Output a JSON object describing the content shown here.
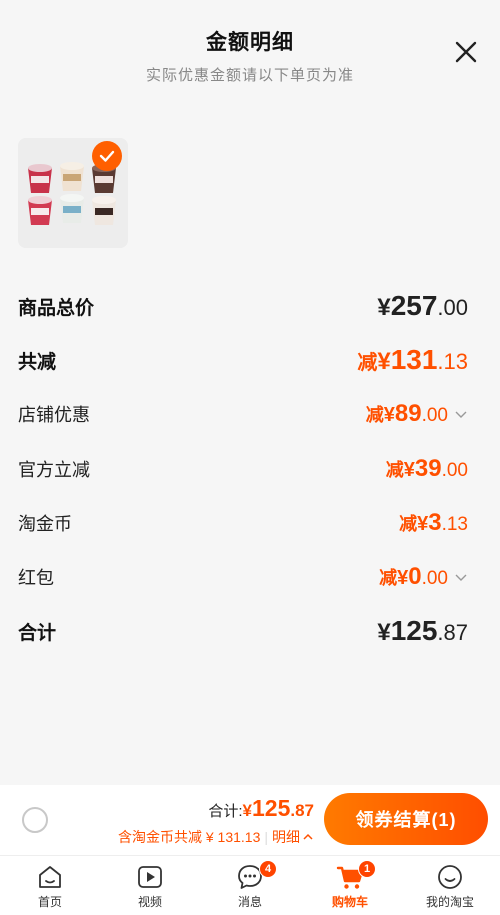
{
  "header": {
    "title": "金额明细",
    "subtitle": "实际优惠金额请以下单页为准"
  },
  "rows": {
    "subtotal": {
      "label": "商品总价",
      "yen": "¥",
      "int": "257",
      "dec": ".00"
    },
    "total_discount": {
      "label": "共减",
      "prefix": "减",
      "yen": "¥",
      "int": "131",
      "dec": ".13"
    },
    "store_coupon": {
      "label": "店铺优惠",
      "prefix": "减",
      "yen": "¥",
      "int": "89",
      "dec": ".00"
    },
    "official_discount": {
      "label": "官方立减",
      "prefix": "减",
      "yen": "¥",
      "int": "39",
      "dec": ".00"
    },
    "taojinbi": {
      "label": "淘金币",
      "prefix": "减",
      "yen": "¥",
      "int": "3",
      "dec": ".13"
    },
    "red_packet": {
      "label": "红包",
      "prefix": "减",
      "yen": "¥",
      "int": "0",
      "dec": ".00"
    },
    "grand_total": {
      "label": "合计",
      "yen": "¥",
      "int": "125",
      "dec": ".87"
    }
  },
  "checkout_bar": {
    "total_label": "合计:",
    "total_yen": "¥",
    "total_int": "125",
    "total_dec": ".87",
    "saving_text": "含淘金币共减 ¥ 131.13",
    "detail_label": "明细",
    "checkout_label": "领券结算(1)"
  },
  "tabbar": {
    "items": [
      {
        "label": "首页",
        "icon": "home-icon"
      },
      {
        "label": "视频",
        "icon": "video-icon"
      },
      {
        "label": "消息",
        "icon": "message-icon",
        "badge": "4"
      },
      {
        "label": "购物车",
        "icon": "cart-icon",
        "badge": "1",
        "active": true
      },
      {
        "label": "我的淘宝",
        "icon": "profile-icon"
      }
    ]
  },
  "colors": {
    "accent": "#ff5000",
    "text": "#222222",
    "muted": "#888888"
  }
}
